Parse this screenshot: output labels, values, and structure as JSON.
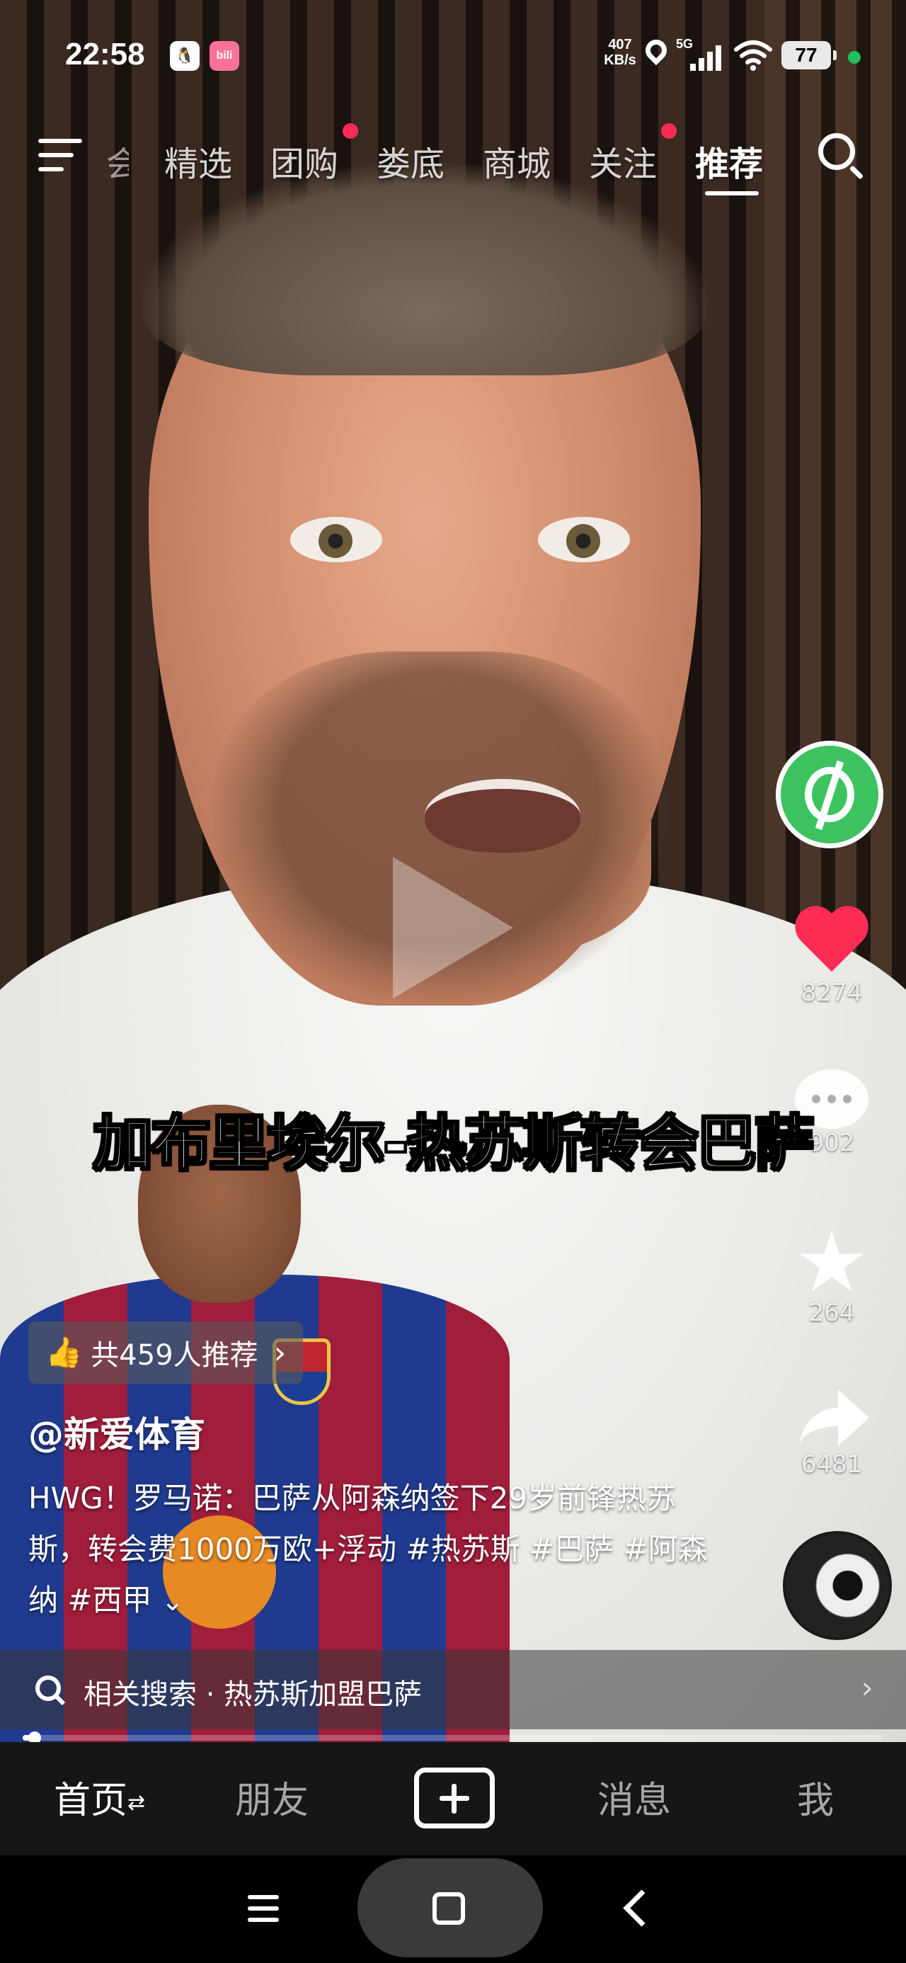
{
  "status_bar": {
    "time": "22:58",
    "net_speed_value": "407",
    "net_speed_unit": "KB/s",
    "network_type": "5G",
    "battery": "77",
    "app_badges": [
      "qq-icon",
      "bilibili-icon"
    ]
  },
  "top_nav": {
    "partial_tab": "会",
    "tabs": [
      {
        "label": "精选",
        "dot": false
      },
      {
        "label": "团购",
        "dot": true
      },
      {
        "label": "娄底",
        "dot": false
      },
      {
        "label": "商城",
        "dot": false
      },
      {
        "label": "关注",
        "dot": true
      },
      {
        "label": "推荐",
        "dot": false,
        "active": true
      }
    ],
    "dot_color": "#fe2c55"
  },
  "video": {
    "caption": "加布里埃尔-热苏斯转会巴萨",
    "author": "@新爱体育",
    "description": "HWG！罗马诺：巴萨从阿森纳签下29岁前锋热苏斯，转会费1000万欧+浮动 #热苏斯 #巴萨 #阿森纳 #西甲",
    "expand_icon": "⌄",
    "recommend": {
      "label": "共459人推荐",
      "chevron": "›"
    },
    "progress_fraction": 0.01
  },
  "right_rail": {
    "likes": "8274",
    "comments": "902",
    "favorites": "264",
    "shares": "6481",
    "like_color": "#fe2c55",
    "avatar_color": "#3cc35f"
  },
  "related_search": {
    "text": "相关搜索 · 热苏斯加盟巴萨",
    "chevron": "›"
  },
  "tab_bar": {
    "home": "首页",
    "home_swap": "⇄",
    "friends": "朋友",
    "messages": "消息",
    "me": "我"
  }
}
